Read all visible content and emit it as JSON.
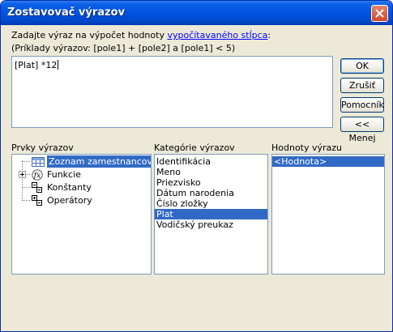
{
  "window": {
    "title": "Zostavovač výrazov"
  },
  "instructions": {
    "line1_prefix": "Zadajte výraz na výpočet hodnoty ",
    "line1_link": "vypočítavaného stĺpca",
    "line1_suffix": ":",
    "line2": "(Príklady výrazov: [pole1] + [pole2] a [pole1] < 5)"
  },
  "expression": {
    "value": "[Plat] *12"
  },
  "buttons": {
    "ok": "OK",
    "cancel": "Zrušiť",
    "help": "Pomocník",
    "less": "<< Menej"
  },
  "elements_panel": {
    "label": "Prvky výrazov",
    "items": [
      {
        "label": "Zoznam zamestnancov",
        "icon": "table-icon",
        "selected": true
      },
      {
        "label": "Funkcie",
        "icon": "function-icon",
        "expandable": true
      },
      {
        "label": "Konštanty",
        "icon": "constants-icon"
      },
      {
        "label": "Operátory",
        "icon": "operators-icon"
      }
    ]
  },
  "categories_panel": {
    "label": "Kategórie výrazov",
    "items": [
      "Identifikácia",
      "Meno",
      "Priezvisko",
      "Dátum narodenia",
      "Číslo zložky",
      "Plat",
      "Vodičský preukaz"
    ],
    "selected": "Plat"
  },
  "values_panel": {
    "label": "Hodnoty výrazu",
    "items": [
      "<Hodnota>"
    ],
    "selected": "<Hodnota>"
  },
  "colors": {
    "titlebar": "#0054e3",
    "selection": "#316ac5",
    "dialog_bg": "#ece9d8"
  }
}
